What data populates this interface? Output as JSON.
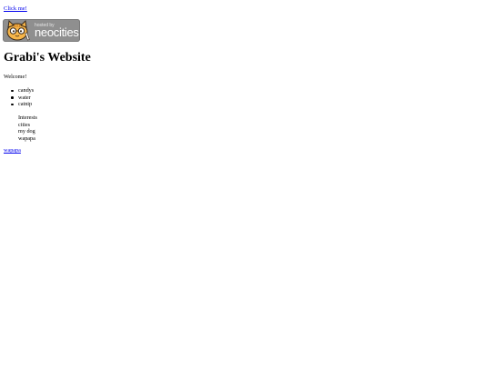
{
  "links": {
    "click_me": "Click me!",
    "bottom": "wapapa"
  },
  "badge": {
    "small_text": "hosted by",
    "big_text": "neocities",
    "colors": {
      "background": "#8f8f8f",
      "cat_fur": "#f6b54a",
      "cat_outline": "#3a2a1a"
    },
    "icon": "neocities-cat-icon"
  },
  "page": {
    "title": "Grabi's Website",
    "welcome": "Welcome!"
  },
  "list1": {
    "items": [
      "candys",
      "water",
      "catnip"
    ]
  },
  "interests": {
    "label": "Interests",
    "items": [
      "cities",
      "my dog",
      "wapapa"
    ]
  }
}
